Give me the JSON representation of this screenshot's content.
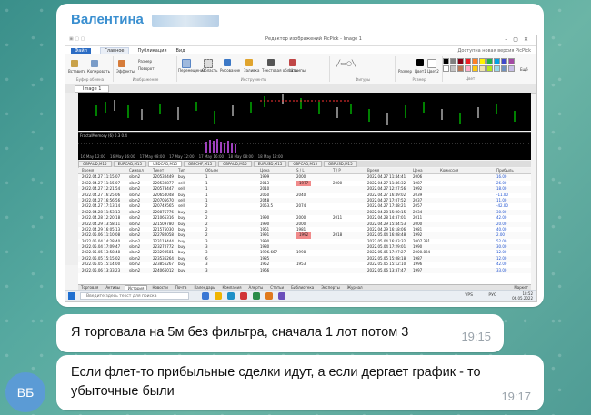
{
  "chat": {
    "sender": "Валентина",
    "avatar_initials": "ВБ",
    "messages": [
      {
        "text": "Я торговала на 5м без фильтра, сначала 1 лот потом 3",
        "time": "19:15"
      },
      {
        "text": "Если флет-то прибыльные сделки идут, а если дергает график - то убыточные были",
        "time": "19:17"
      }
    ]
  },
  "screenshot": {
    "window_title": "Редактор изображений PicPick - Image 1",
    "ribbon_tabs": [
      "Файл",
      "Главное",
      "Публикация",
      "Вид"
    ],
    "ribbon_right": "Доступна новая версия PicPick",
    "ribbon_groups": [
      "Буфер обмена",
      "Изображение",
      "Инструменты",
      "Фигуры",
      "Размер",
      "Цвет"
    ],
    "ribbon_items": [
      "Вставить",
      "Копировать",
      "Эффекты",
      "Размер",
      "Поворот",
      "Перемещение",
      "Область",
      "Рисование",
      "Заливка",
      "Текстовая область",
      "Штампы",
      "Размер",
      "Цвет1",
      "Цвет2",
      "Ещё"
    ],
    "doc_tab": "Image 1",
    "indicator_label": "FractalMemory (6) 0.3 0.4",
    "symbol_tabs": [
      "GBPAUD,M15",
      "EURCAD,M15",
      "USDCAD,M15",
      "GBPCHF,M15",
      "GBPAUD,M15",
      "EURUSD,M15",
      "GBPCAD,M15",
      "GBPUSD,M15"
    ],
    "table_headers": [
      "Время",
      "Символ",
      "Тикет",
      "Тип",
      "Объем",
      "Цена",
      "S / L",
      "T / P",
      "Время",
      "Цена",
      "Комиссия",
      "Прибыль"
    ],
    "rows": [
      [
        "2022.04.27 11:15:07",
        "sibm2",
        "220530449",
        "buy",
        "1",
        "1999",
        "2000",
        "",
        "2022.04.27 11:44:41",
        "2006",
        "",
        "16.00"
      ],
      [
        "2022.04.27 11:15:07",
        "sibm2",
        "220530877",
        "sell",
        "1",
        "2013",
        "1977",
        "2000",
        "2022.04.27 11:46:32",
        "1987",
        "",
        "26.00"
      ],
      [
        "2022.04.27 12:21:54",
        "sibm2",
        "220578447",
        "sell",
        "1",
        "2010",
        "",
        "",
        "2022.04.27 12:27:56",
        "1992",
        "",
        "18.00"
      ],
      [
        "2022.04.27 16:25:06",
        "sibm2",
        "220654048",
        "buy",
        "1",
        "2050",
        "2040",
        "",
        "2022.04.27 16:49:02",
        "2039",
        "",
        "-11.00"
      ],
      [
        "2022.04.27 16:56:56",
        "sibm2",
        "220705670",
        "sell",
        "1",
        "2048",
        "",
        "",
        "2022.04.27 17:07:52",
        "2037",
        "",
        "11.00"
      ],
      [
        "2022.04.27 17:13:14",
        "sibm2",
        "220749565",
        "sell",
        "2",
        "2053.5",
        "2074",
        "",
        "2022.04.27 17:48:21",
        "2057",
        "",
        "-42.00"
      ],
      [
        "2022.04.28 11:53:13",
        "sibm2",
        "220875776",
        "buy",
        "2",
        "",
        "",
        "",
        "2022.04.28 15:00:15",
        "2034",
        "",
        "30.00"
      ],
      [
        "2022.04.28 12:20:18",
        "sibm2",
        "221065316",
        "buy",
        "2",
        "1990",
        "2000",
        "2011",
        "2022.04.28 14:37:01",
        "2011",
        "",
        "42.00"
      ],
      [
        "2022.04.29 13:58:11",
        "sibm2",
        "221509780",
        "buy",
        "2",
        "1990",
        "2000",
        "",
        "2022.04.29 15:44:53",
        "2000",
        "",
        "20.00"
      ],
      [
        "2022.04.29 16:05:13",
        "sibm2",
        "221575030",
        "buy",
        "2",
        "1961",
        "1981",
        "",
        "2022.04.29 16:18:06",
        "1981",
        "",
        "40.00"
      ],
      [
        "2022.05.06 11:10:08",
        "sibm2",
        "222780058",
        "buy",
        "2",
        "1991",
        "1992",
        "2018",
        "2022.05.04 16:08:48",
        "1992",
        "",
        "2.00"
      ],
      [
        "2022.05.04 14:28:40",
        "sibm2",
        "223119444",
        "buy",
        "3",
        "1990",
        "",
        "",
        "2022.05.04 16:03:32",
        "2007.331",
        "",
        "52.00"
      ],
      [
        "2022.05.04 17:09:47",
        "sibm2",
        "223270772",
        "buy",
        "3",
        "1980",
        "",
        "",
        "2022.05.04 17:29:01",
        "1990",
        "",
        "30.00"
      ],
      [
        "2022.05.05 13:58:48",
        "sibm2",
        "223290581",
        "buy",
        "3",
        "1996.667",
        "1998",
        "",
        "2022.05.05 17:27:27",
        "2000.824",
        "",
        "12.00"
      ],
      [
        "2022.05.05 15:15:02",
        "sibm2",
        "223536264",
        "buy",
        "6",
        "1985",
        "",
        "",
        "2022.05.05 15:08:18",
        "1987",
        "",
        "12.00"
      ],
      [
        "2022.05.05 15:14:00",
        "sibm2",
        "223856267",
        "buy",
        "3",
        "1952",
        "1953",
        "",
        "2022.05.05 15:12:10",
        "1996",
        "",
        "42.00"
      ],
      [
        "2022.05.06 13:33:23",
        "sibm2",
        "224066012",
        "buy",
        "3",
        "1966",
        "",
        "",
        "2022.05.06 13:37:47",
        "1997",
        "",
        "33.00"
      ]
    ],
    "bottom_tabs": [
      "Торговля",
      "Активы",
      "История",
      "Новости",
      "Почта",
      "Календарь",
      "Компания",
      "Алерты",
      "Статьи",
      "Библиотека",
      "Эксперты",
      "Журнал"
    ],
    "bottom_right": "Маркет",
    "taskbar_search": "Введите здесь текст для поиска",
    "tray_time": "18:52",
    "tray_date": "06.05.2022",
    "tray_lang": "РУС",
    "tray_vps": "VPS"
  },
  "colors": {
    "sender": "#3a8fd0",
    "profit_blue": "#1b4fd0",
    "sl_red": "#f08a8a",
    "avatar": "#5b9bd5"
  }
}
